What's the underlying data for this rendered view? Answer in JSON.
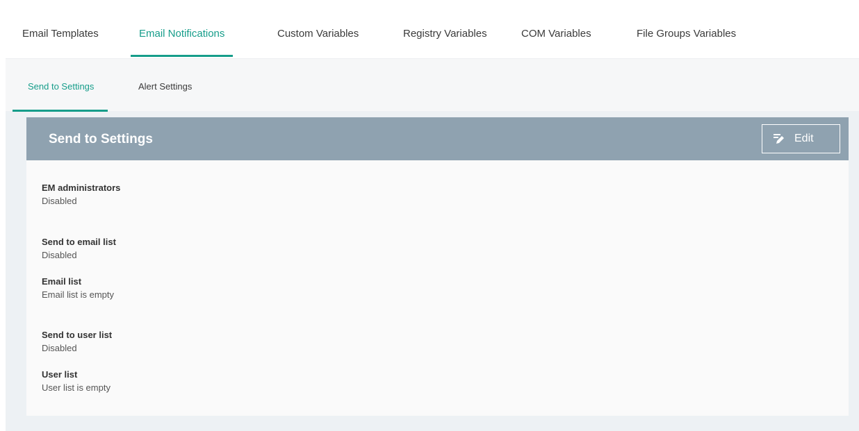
{
  "main_tabs": {
    "email_templates": "Email Templates",
    "email_notifications": "Email Notifications",
    "custom_variables": "Custom Variables",
    "registry_variables": "Registry Variables",
    "com_variables": "COM Variables",
    "file_groups_variables": "File Groups Variables",
    "active": "Email Notifications"
  },
  "sub_tabs": {
    "send_to_settings": "Send to Settings",
    "alert_settings": "Alert Settings",
    "active": "Send to Settings"
  },
  "panel": {
    "title": "Send to Settings",
    "edit_label": "Edit",
    "edit_icon": "pencil-edit-icon",
    "fields": [
      {
        "label": "EM administrators",
        "value": "Disabled"
      },
      {
        "label": "Send to email list",
        "value": "Disabled"
      },
      {
        "label": "Email list",
        "value": "Email list is empty"
      },
      {
        "label": "Send to user list",
        "value": "Disabled"
      },
      {
        "label": "User list",
        "value": "User list is empty"
      }
    ]
  },
  "colors": {
    "accent": "#169d8a",
    "panel_header": "#8fa2b0",
    "page_background": "#edf1f4"
  }
}
